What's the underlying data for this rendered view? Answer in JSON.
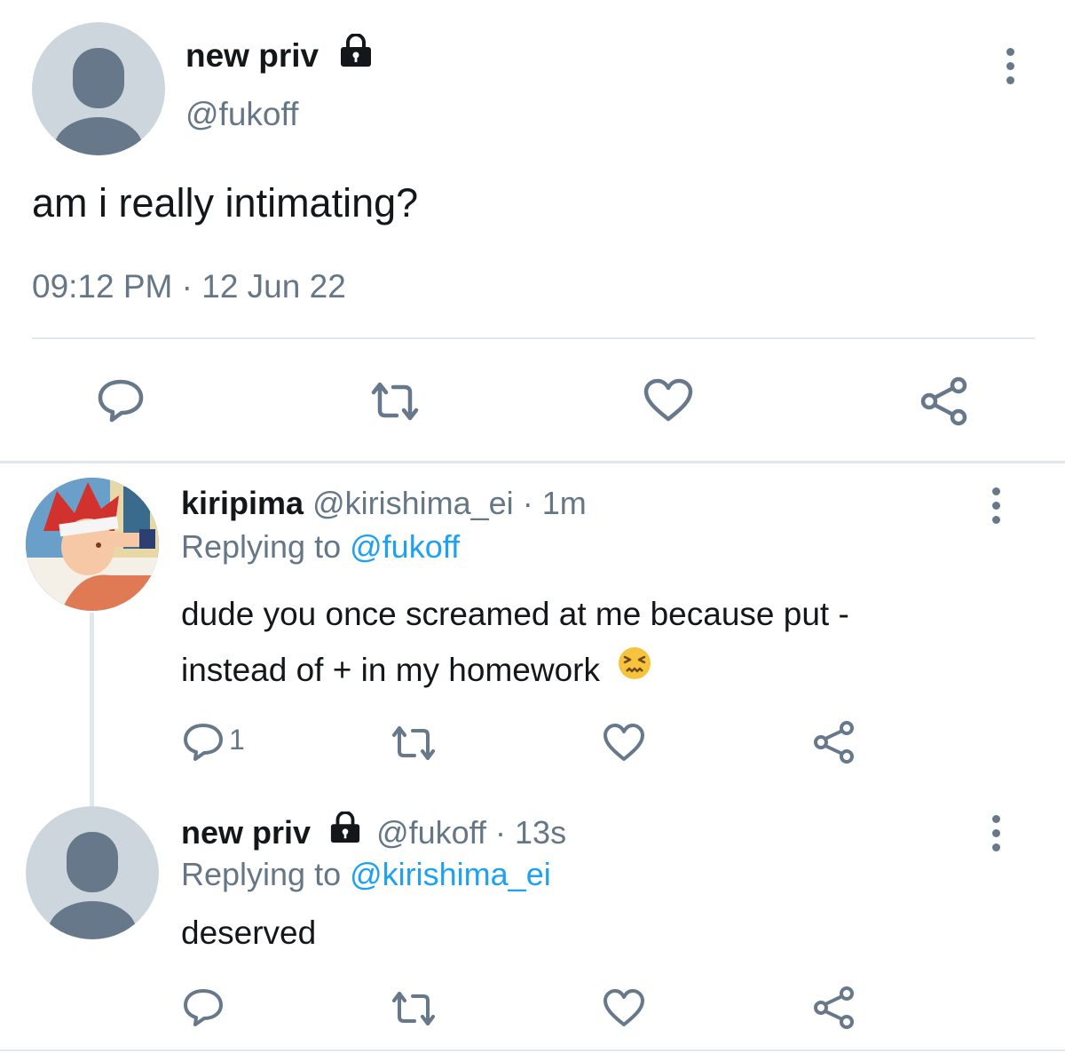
{
  "main_tweet": {
    "name": "new priv",
    "handle": "@fukoff",
    "text": "am i really intimating?",
    "timestamp": "09:12 PM · 12 Jun 22",
    "locked": true
  },
  "replies": [
    {
      "name": "kiripima",
      "handle": "@kirishima_ei",
      "time": "· 1m",
      "replying_prefix": "Replying to",
      "replying_to": "@fukoff",
      "text_line1": "dude you once screamed at me because put -",
      "text_line2": "instead of + in my homework",
      "emoji": "😖",
      "reply_count": "1"
    },
    {
      "name": "new priv",
      "handle": "@fukoff",
      "time": "· 13s",
      "replying_prefix": "Replying to",
      "replying_to": "@kirishima_ei",
      "text": "deserved",
      "locked": true
    }
  ],
  "colors": {
    "accent": "#1da1f2",
    "icon": "#66788a",
    "divider": "#e1e8ed"
  }
}
